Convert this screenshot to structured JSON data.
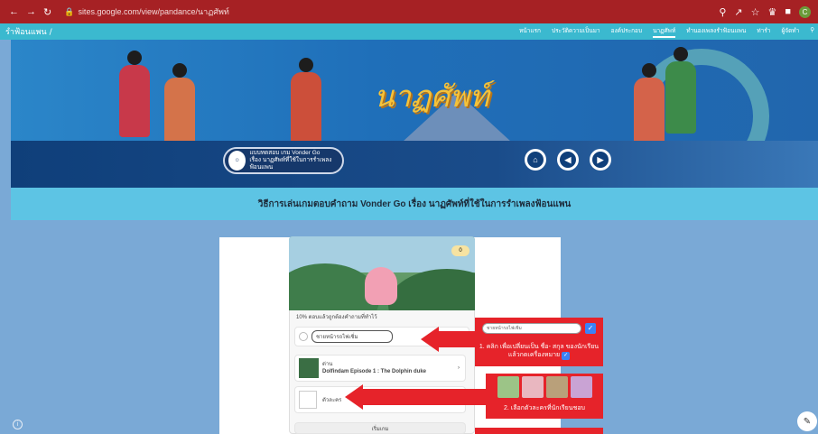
{
  "browser": {
    "url": "sites.google.com/view/pandance/นาฏศัพท์",
    "profile_initial": "C"
  },
  "site": {
    "name": "รำฟ้อนแพน /",
    "menu": [
      "หน้าแรก",
      "ประวัติความเป็นมา",
      "องค์ประกอบ",
      "นาฏศัพท์",
      "ทำนองเพลงรำฟ้อนแพน",
      "ท่ารำ",
      "ผู้จัดทำ"
    ],
    "active_menu_index": 3
  },
  "banner": {
    "title": "นาฏศัพท์"
  },
  "vonder_button": {
    "line1": "แบบทดสอบ เกม Vonder Go",
    "line2": "เรื่อง นาฏศัพท์ที่ใช้ในการรำเพลงฟ้อนแพน"
  },
  "heading": "วิธีการเล่นเกมตอบคำถาม Vonder Go เรื่อง นาฏศัพท์ที่ใช้ในการรำเพลงฟ้อนแพน",
  "phone": {
    "coin_value": "0",
    "progress_text": "10% ตอบแล้วถูกต้องคำถามที่ทำไว้",
    "name_placeholder": "ชายหน้ารถไฟเชิ่ม",
    "episode_label": "ด่าน",
    "episode_title": "Dolfindam Episode 1 : The Dolphin duke",
    "avatar_label": "ตัวละคร",
    "submit_label": "เริ่มเกม"
  },
  "instructions": {
    "step1_input": "ชายหน้ารถไฟเชิ่ม",
    "step1_text_a": "1. คลิก เพื่อเปลี่ยนเป็น ชื่อ- สกุล ของนักเรียน",
    "step1_text_b": "แล้วกดเครื่องหมาย",
    "step2_text": "2. เลือกตัวละครที่นักเรียนชอบ"
  },
  "colors": {
    "browser_bar": "#a62124",
    "site_bar": "#3bb9cf",
    "highlight_red": "#e6232a",
    "banner_title": "#f5c33a"
  }
}
